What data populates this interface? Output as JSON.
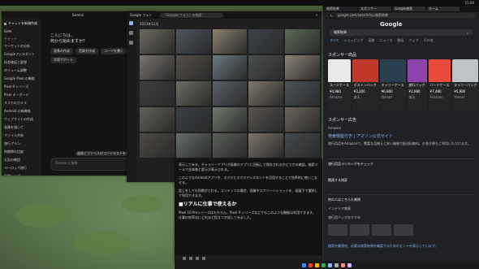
{
  "gemini": {
    "title": "Gemini",
    "greeting": "こんにちは、",
    "question": "何から始めますか？",
    "sidebar_new_chat": "チャットを新規作成",
    "sidebar_gems": "Gem",
    "sidebar_recent_label": "チャット",
    "sidebar_recent": [
      "マーケットの分析",
      "Googleアシスタント",
      "料金確認と要望",
      "ボリューム調整",
      "Google Pixel の機能",
      "Pixel 9 シリーズ",
      "Pixel キーボード",
      "スマホのカメラ",
      "Android の新機能",
      "ウェブサイトの作成",
      "画像を描いて",
      "ファイル共有",
      "旅行プラン",
      "時間帯の比較",
      "天気の確認",
      "ヨーロッパ旅行",
      "料理レシピ",
      "カレンダー"
    ],
    "chips": [
      "画像の作成",
      "音楽を作成",
      "コードを書く",
      "学習サポート"
    ],
    "input_placeholder": "Gemini に質問",
    "hint": "画像とファイルのコンテキストを共有"
  },
  "photos": {
    "app_title": "Google フォト",
    "search_placeholder": "「Google フォト」を検索",
    "date_label": "2023年11月"
  },
  "document": {
    "paragraphs": [
      "表示してみる。ギャラリーアプリが画像のアプリに回転して保存されるかどうかの確認。検索ツールで全体像と提示が表示される。",
      "このようなAndroidアプリや、スマホとスマホアシスタントを活用することで効率的に使いこなせる。",
      "話しをしても同期がとれる。コンテンツの場合、画像やスクリーンショットを、画面下で選択して利用できます。"
    ],
    "heading": "■リアルに仕事で使えるか",
    "paragraph_last": "Pixel 10 Proシリーズはもちろん、Pixel 9 シリーズなどでもこのような機能は利用できます。仕事の効率化にどれほど役立つか試してみました。"
  },
  "browser": {
    "tabs": [
      "検索結果",
      "スポンサー",
      "Google検索",
      "ホーム"
    ],
    "url": "google.com/search?q=検索結果",
    "search_query": "検索結果",
    "filters": [
      "すべて",
      "ショッピング",
      "画像",
      "ニュース",
      "動画",
      "ウェブ",
      "その他"
    ],
    "sponsored_label": "スポンサー商品",
    "products": [
      {
        "name": "スーツケース",
        "price": "¥4,980",
        "store": "Amazon"
      },
      {
        "name": "ボストンバッグ",
        "price": "¥3,200",
        "store": "楽天"
      },
      {
        "name": "キャリーケース",
        "price": "¥6,800",
        "store": "Yahoo!"
      },
      {
        "name": "旅行バッグ",
        "price": "¥2,980",
        "store": "楽天"
      },
      {
        "name": "ハードケース",
        "price": "¥7,480",
        "store": "Amazon"
      },
      {
        "name": "キャリーバッグ",
        "price": "¥5,980",
        "store": "Yahoo!"
      },
      {
        "name": "機内持込",
        "price": "¥8,900",
        "store": "楽天"
      }
    ],
    "ad_label": "スポンサー広告",
    "ad_site": "Amazon",
    "ad_title": "検索機能付き | アマゾン公式サイト",
    "ad_desc": "旅行用品をAmazonで。豊富な品揃えと安い価格で配送料無料。お急ぎ便もご利用いただけます。",
    "sub_title": "旅行用品ランキングをチェック",
    "sub_title2": "関連する検索",
    "faq_title": "他の人はこちらも質問",
    "faq_items": [
      "インテリア雑貨",
      "旅行用バッグおすすめ"
    ],
    "bottom_link": "検索を最適化、必要な検索結果を確認するためのヒントを表示しています。"
  },
  "time": "15:00"
}
